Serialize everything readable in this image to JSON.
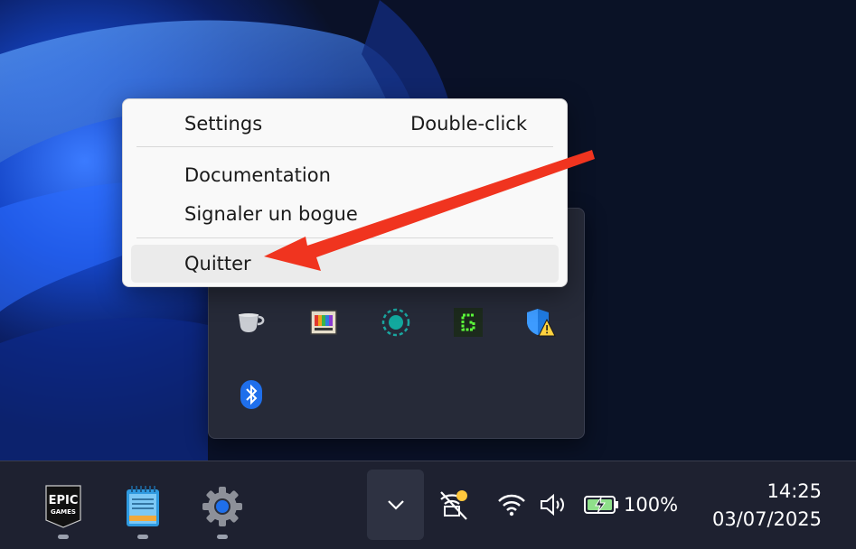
{
  "context_menu": {
    "items": [
      {
        "label": "Settings",
        "shortcut": "Double-click"
      },
      {
        "label": "Documentation",
        "shortcut": ""
      },
      {
        "label": "Signaler un bogue",
        "shortcut": ""
      },
      {
        "label": "Quitter",
        "shortcut": ""
      }
    ],
    "hovered_item": "Quitter"
  },
  "tray_overflow": {
    "icons": [
      "coffee-cup-icon",
      "color-palette-app-icon",
      "circle-sync-icon",
      "green-g-app-icon",
      "windows-security-warning-icon",
      "bluetooth-icon"
    ]
  },
  "taskbar": {
    "apps": [
      {
        "name": "epic-games",
        "logo_line1": "EPIC",
        "logo_line2": "GAMES"
      },
      {
        "name": "notepad"
      },
      {
        "name": "settings"
      }
    ],
    "battery_percent": "100%",
    "time": "14:25",
    "date": "03/07/2025"
  },
  "colors": {
    "annotation_arrow": "#f0341f",
    "menu_background": "#f9f9f9",
    "taskbar_background": "#1e2130",
    "accent_blue": "#1f6feb"
  }
}
